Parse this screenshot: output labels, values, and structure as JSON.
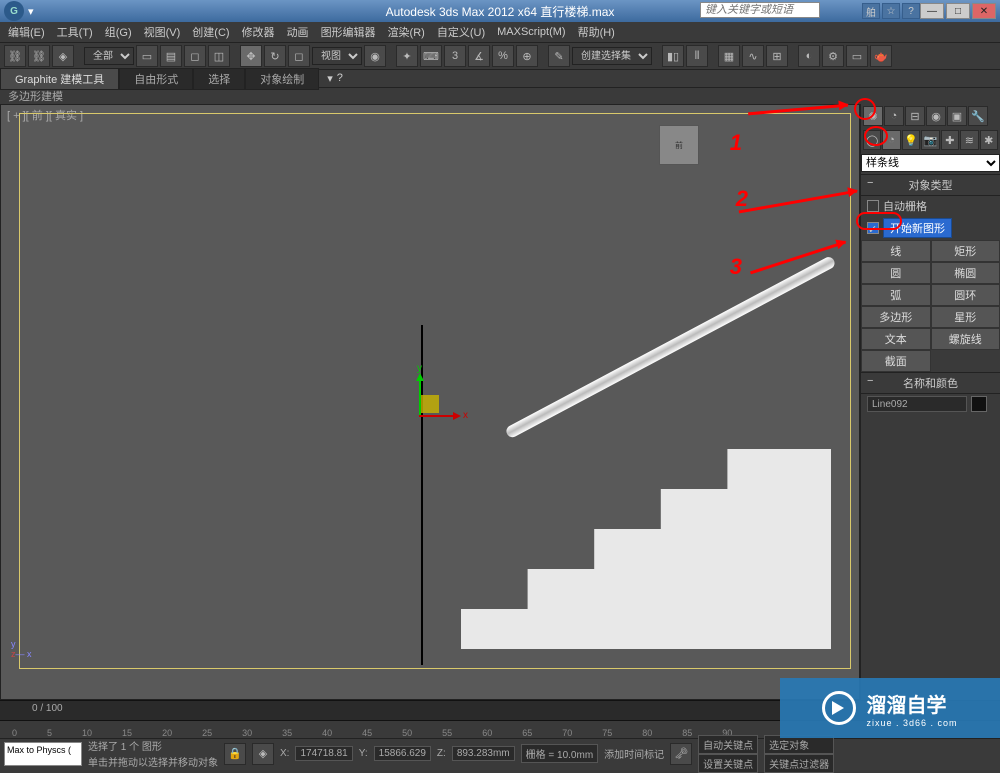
{
  "title": "Autodesk 3ds Max  2012 x64      直行楼梯.max",
  "search_placeholder": "键入关键字或短语",
  "menu": [
    "编辑(E)",
    "工具(T)",
    "组(G)",
    "视图(V)",
    "创建(C)",
    "修改器",
    "动画",
    "图形编辑器",
    "渲染(R)",
    "自定义(U)",
    "MAXScript(M)",
    "帮助(H)"
  ],
  "toolbar_all": "全部",
  "toolbar_view": "视图",
  "toolbar_sel_set": "创建选择集",
  "ribbon_tabs": [
    "Graphite 建模工具",
    "自由形式",
    "选择",
    "对象绘制"
  ],
  "subribbon": "多边形建模",
  "viewport_label": "[ + ][ 前 ][ 真实 ]",
  "gizmo_x": "x",
  "gizmo_y": "y",
  "viewcube": "前",
  "cmd": {
    "spline_dd": "样条线",
    "section_types": "对象类型",
    "auto_grid": "自动栅格",
    "start_new": "开始新图形",
    "buttons": [
      "线",
      "矩形",
      "圆",
      "椭圆",
      "弧",
      "圆环",
      "多边形",
      "星形",
      "文本",
      "螺旋线",
      "截面"
    ],
    "section_name": "名称和颜色",
    "obj_name": "Line092"
  },
  "slider_frame": "0 / 100",
  "ticks": [
    "0",
    "5",
    "10",
    "15",
    "20",
    "25",
    "30",
    "35",
    "40",
    "45",
    "50",
    "55",
    "60",
    "65",
    "70",
    "75",
    "80",
    "85",
    "90"
  ],
  "status": {
    "mxs": "Max to Physcs (",
    "sel": "选择了 1 个 图形",
    "prompt": "单击并拖动以选择并移动对象",
    "x": "174718.81",
    "y": "15866.629",
    "z": "893.283mm",
    "grid": "栅格 = 10.0mm",
    "addtime": "添加时间标记",
    "autokey": "自动关键点",
    "selonly": "选定对象",
    "setkey": "设置关键点",
    "keyfilter": "关键点过滤器"
  },
  "wm_big": "溜溜自学",
  "wm_small": "zixue . 3d66 . com",
  "annot": {
    "n1": "1",
    "n2": "2",
    "n3": "3"
  }
}
